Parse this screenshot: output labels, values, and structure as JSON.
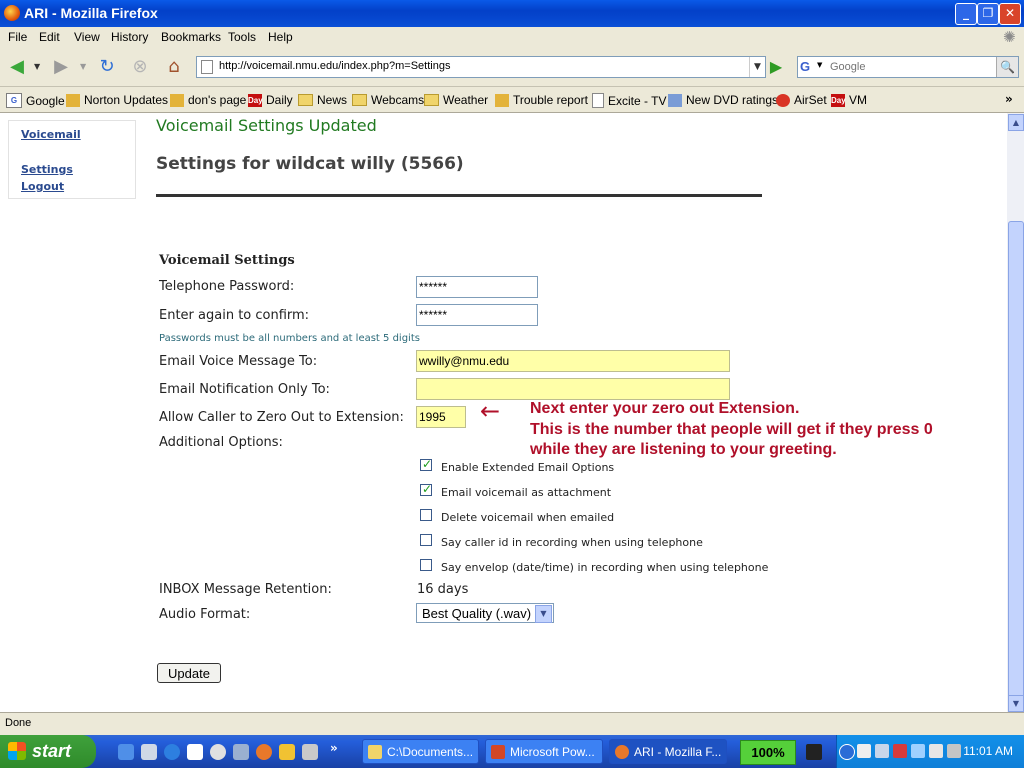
{
  "window": {
    "title": "ARI - Mozilla Firefox",
    "minimize": "_",
    "maximize": "❐",
    "close": "✕"
  },
  "menu": [
    "File",
    "Edit",
    "View",
    "History",
    "Bookmarks",
    "Tools",
    "Help"
  ],
  "nav": {
    "url": "http://voicemail.nmu.edu/index.php?m=Settings",
    "search_placeholder": "Google",
    "search_engine": "G"
  },
  "bookmarks": [
    "Google",
    "Norton Updates",
    "don's page",
    "Daily",
    "News",
    "Webcams",
    "Weather",
    "Trouble report",
    "Excite - TV",
    "New DVD ratings",
    "AirSet",
    "VM"
  ],
  "sidebar": {
    "voicemail": "Voicemail",
    "settings": "Settings",
    "logout": "Logout"
  },
  "page": {
    "updated": "Voicemail Settings Updated",
    "title": "Settings for wildcat willy (5566)",
    "section": "Voicemail Settings",
    "pw_label": "Telephone Password:",
    "pw_value": "******",
    "confirm_label": "Enter again to confirm:",
    "confirm_value": "******",
    "pw_hint": "Passwords must be all numbers and at least 5 digits",
    "email_label": "Email Voice Message To:",
    "email_value": "wwilly@nmu.edu",
    "notify_label": "Email Notification Only To:",
    "notify_value": "",
    "zero_label": "Allow Caller to Zero Out to Extension:",
    "zero_value": "1995",
    "options_label": "Additional Options:",
    "options": [
      {
        "label": "Enable Extended Email Options",
        "checked": true
      },
      {
        "label": "Email voicemail as attachment",
        "checked": true
      },
      {
        "label": "Delete voicemail when emailed",
        "checked": false
      },
      {
        "label": "Say caller id in recording when using telephone",
        "checked": false
      },
      {
        "label": "Say envelop (date/time) in recording when using telephone",
        "checked": false
      }
    ],
    "retention_label": "INBOX Message Retention:",
    "retention_value": "16 days",
    "audio_label": "Audio Format:",
    "audio_value": "Best Quality (.wav)",
    "update_button": "Update"
  },
  "annotation": {
    "arrow": "←",
    "line1": "Next enter your zero out Extension.",
    "line2": "This is the number that people will get if they press 0",
    "line3": "while they are listening to your greeting."
  },
  "status": "Done",
  "taskbar": {
    "start": "start",
    "tasks": [
      "C:\\Documents...",
      "Microsoft Pow...",
      "ARI - Mozilla F..."
    ],
    "zoom": "100%",
    "time": "11:01 AM"
  },
  "colors": {
    "accent": "#217a21",
    "annotation": "#b0102a",
    "highlight_field": "#ffffa8"
  }
}
